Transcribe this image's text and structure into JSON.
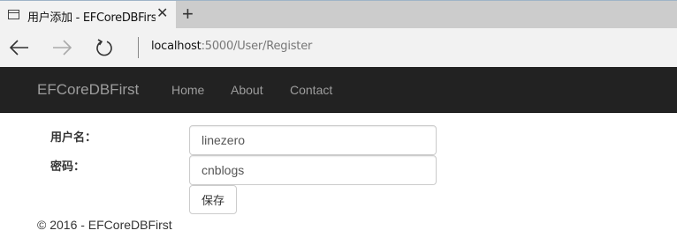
{
  "browser": {
    "tab": {
      "title": "用户添加 - EFCoreDBFirst",
      "close_glyph": "✕",
      "icon": "page-icon"
    },
    "new_tab_glyph": "+",
    "nav": {
      "back_icon": "back-arrow-icon",
      "forward_icon": "forward-arrow-icon",
      "refresh_icon": "refresh-icon"
    },
    "address": {
      "host": "localhost",
      "rest": ":5000/User/Register"
    }
  },
  "site": {
    "brand": "EFCoreDBFirst",
    "nav_links": [
      "Home",
      "About",
      "Contact"
    ],
    "navbar_color": "#222222",
    "link_color": "#9d9d9d"
  },
  "form": {
    "username_label": "用户名：",
    "username_value": "linezero",
    "password_label": "密码：",
    "password_value": "cnblogs",
    "submit_label": "保存"
  },
  "footer": {
    "text": "© 2016 - EFCoreDBFirst"
  }
}
